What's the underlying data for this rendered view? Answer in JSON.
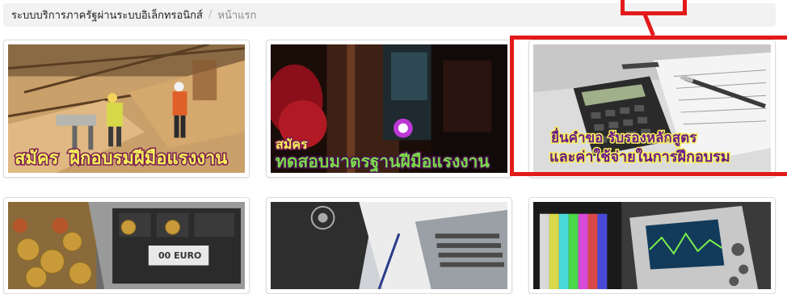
{
  "breadcrumb": {
    "home": "ระบบบริการภาครัฐผ่านระบบอิเล็กทรอนิกส์",
    "separator": "/",
    "current": "หน้าแรก"
  },
  "cards": [
    {
      "line1": "สมัคร",
      "line2": "ฝึกอบรมฝีมือแรงงาน"
    },
    {
      "line1": "สมัคร",
      "line2": "ทดสอบมาตรฐานฝีมือแรงงาน"
    },
    {
      "line1": "ยื่นคำขอ รับรองหลักสูตร",
      "line2": "และค่าใช้จ่ายในการฝึกอบรม"
    },
    {
      "note": "00 EURO"
    },
    {},
    {}
  ],
  "colors": {
    "highlight": "#e31a1a",
    "caption_fill": "#f4f05a",
    "caption_stroke": "#7a1a55"
  }
}
